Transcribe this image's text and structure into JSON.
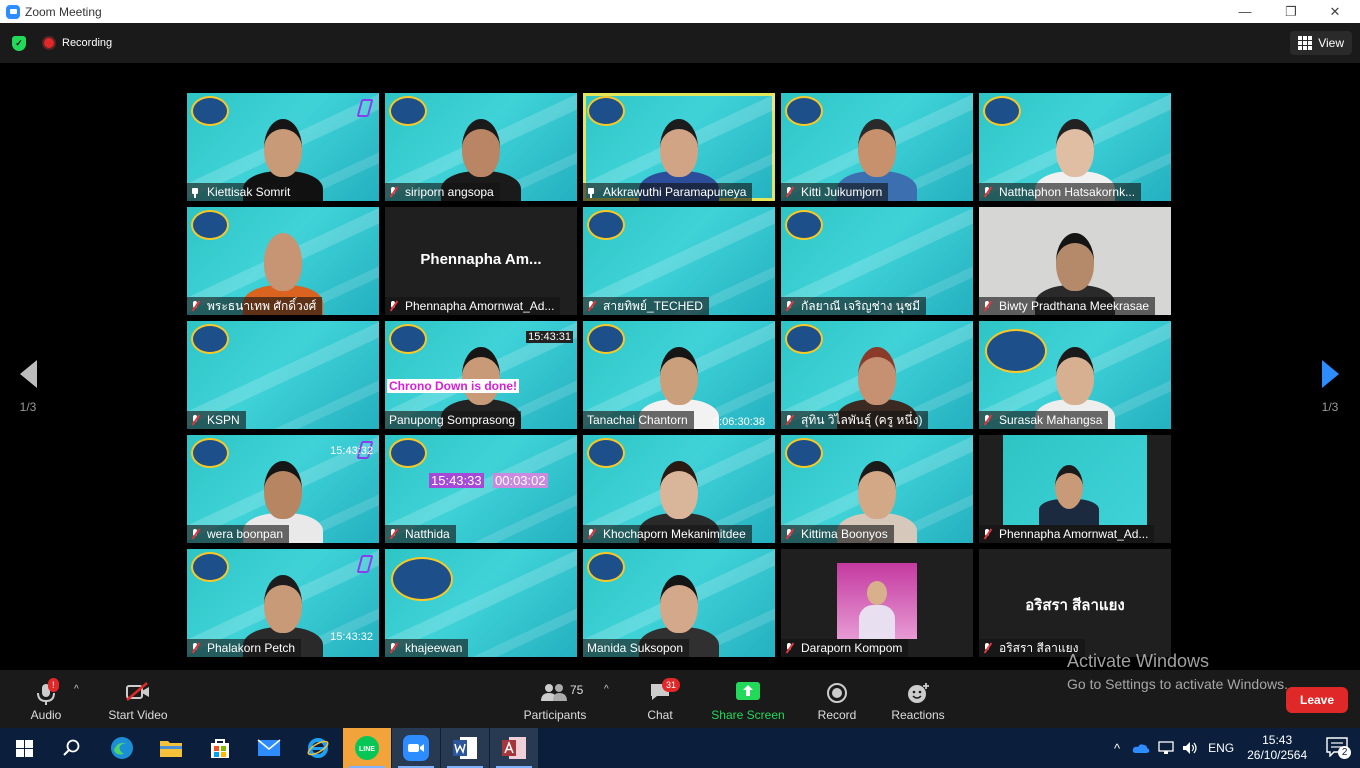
{
  "window": {
    "title": "Zoom Meeting",
    "minimize": "—",
    "maximize": "❐",
    "close": "✕"
  },
  "topbar": {
    "recording_label": "Recording",
    "view_label": "View"
  },
  "nav": {
    "page_indicator": "1/3"
  },
  "tiles": [
    {
      "name": "Kiettisak Somrit",
      "mic": "pin",
      "style": "teal",
      "cornerlogo": true,
      "person": {
        "skin": "#c99a78",
        "shirt": "#111",
        "hair": "#151515"
      }
    },
    {
      "name": "siriporn angsopa",
      "mic": "muted",
      "style": "teal",
      "person": {
        "skin": "#b98565",
        "shirt": "#1a1a1a",
        "hair": "#1a1a1a"
      }
    },
    {
      "name": "Akkrawuthi Paramapuneya",
      "mic": "pin",
      "style": "teal",
      "active": true,
      "person": {
        "skin": "#d1a486",
        "shirt": "#2c4e9a",
        "hair": "#1c1c1c"
      }
    },
    {
      "name": "Kitti Juikumjorn",
      "mic": "muted",
      "style": "teal",
      "person": {
        "skin": "#c6916c",
        "shirt": "#3b6fb0",
        "hair": "#2a2a2a"
      }
    },
    {
      "name": "Natthaphon Hatsakornk...",
      "mic": "muted",
      "style": "teal",
      "person": {
        "skin": "#e0bea3",
        "shirt": "#f1f1f1",
        "hair": "#222"
      }
    },
    {
      "name": "พระธนาเทพ ศักดิ์วงศ์",
      "mic": "muted",
      "style": "teal",
      "person": {
        "skin": "#c79474",
        "shirt": "#d9631f",
        "hair": "#c79474"
      }
    },
    {
      "name": "Phennapha Amornwat_Ad...",
      "mic": "muted",
      "style": "dark",
      "bigname": "Phennapha  Am..."
    },
    {
      "name": "สายทิพย์_TECHED",
      "mic": "muted",
      "style": "teal"
    },
    {
      "name": "กัลยาณี เจริญช่าง นุชมี",
      "mic": "muted",
      "style": "teal"
    },
    {
      "name": "Biwty Pradthana Meekrasae",
      "mic": "muted",
      "style": "gray",
      "person": {
        "skin": "#b58a6b",
        "shirt": "#2a2a2a",
        "hair": "#141414"
      }
    },
    {
      "name": "KSPN",
      "mic": "muted",
      "style": "teal"
    },
    {
      "name": "Panupong Somprasong",
      "mic": "none",
      "style": "teal",
      "overlay1": "Chrono Down is done!",
      "overlay2": "15:43:31",
      "person": {
        "skin": "#c99a78",
        "shirt": "#222",
        "hair": "#151515"
      }
    },
    {
      "name": "Tanachai Chantorn",
      "mic": "none",
      "style": "teal",
      "overlay2": "0:06:30:38",
      "person": {
        "skin": "#caa07c",
        "shirt": "#f2f2f2",
        "hair": "#151515"
      }
    },
    {
      "name": "สุทิน วิไลพันธุ์ (ครู หนึ่ง)",
      "mic": "muted",
      "style": "teal",
      "person": {
        "skin": "#c69172",
        "shirt": "#3a2a22",
        "hair": "#8c3a2a"
      }
    },
    {
      "name": "Surasak Mahangsa",
      "mic": "muted",
      "style": "teal",
      "bigbadge": true,
      "person": {
        "skin": "#d6b090",
        "shirt": "#eeeeee",
        "hair": "#1a1a1a"
      }
    },
    {
      "name": "wera boonpan",
      "mic": "muted",
      "style": "teal",
      "cornerlogo": true,
      "overlay2": "15:43:32",
      "person": {
        "skin": "#b88563",
        "shirt": "#e9e9e9",
        "hair": "#151515"
      }
    },
    {
      "name": "Natthida",
      "mic": "muted",
      "style": "teal",
      "overlay2": "15:43:33",
      "overlay3": "00:03:02"
    },
    {
      "name": "Khochaporn Mekanimitdee",
      "mic": "muted",
      "style": "teal",
      "person": {
        "skin": "#d9b69a",
        "shirt": "#2a2a2a",
        "hair": "#2a1a12"
      }
    },
    {
      "name": "Kittima Boonyos",
      "mic": "muted",
      "style": "teal",
      "person": {
        "skin": "#d2a886",
        "shirt": "#d6c8ba",
        "hair": "#1a1a1a"
      }
    },
    {
      "name": "Phennapha Amornwat_Ad...",
      "mic": "muted",
      "style": "dark",
      "inset": true
    },
    {
      "name": "Phalakorn Petch",
      "mic": "muted",
      "style": "teal",
      "cornerlogo": true,
      "overlay2": "15:43:32",
      "person": {
        "skin": "#c99a78",
        "shirt": "#2a2a2a",
        "hair": "#1c1c1c"
      }
    },
    {
      "name": "khajeewan",
      "mic": "muted",
      "style": "teal",
      "bigbadge": true
    },
    {
      "name": "Manida Suksopon",
      "mic": "none",
      "style": "teal",
      "person": {
        "skin": "#d4a88a",
        "shirt": "#303030",
        "hair": "#151515"
      }
    },
    {
      "name": "Daraporn Kompom",
      "mic": "muted",
      "style": "dark",
      "photo": true
    },
    {
      "name": "อริสรา สีลาแยง",
      "mic": "muted",
      "style": "dark",
      "bigname": "อริสรา สีลาแยง"
    }
  ],
  "controls": {
    "audio": "Audio",
    "video": "Start Video",
    "participants": "Participants",
    "participants_count": "75",
    "chat": "Chat",
    "chat_badge": "31",
    "share": "Share Screen",
    "record": "Record",
    "reactions": "Reactions",
    "leave": "Leave",
    "audio_alert": "!"
  },
  "activation": {
    "line1": "Activate Windows",
    "line2": "Go to Settings to activate Windows."
  },
  "taskbar": {
    "lang": "ENG",
    "time": "15:43",
    "date": "26/10/2564",
    "notif_count": "2",
    "line_label": "LINE"
  },
  "colors": {
    "zoom_blue": "#2d8cff",
    "share_green": "#23d959",
    "leave_red": "#e02828",
    "teal": "#34c8cc"
  }
}
